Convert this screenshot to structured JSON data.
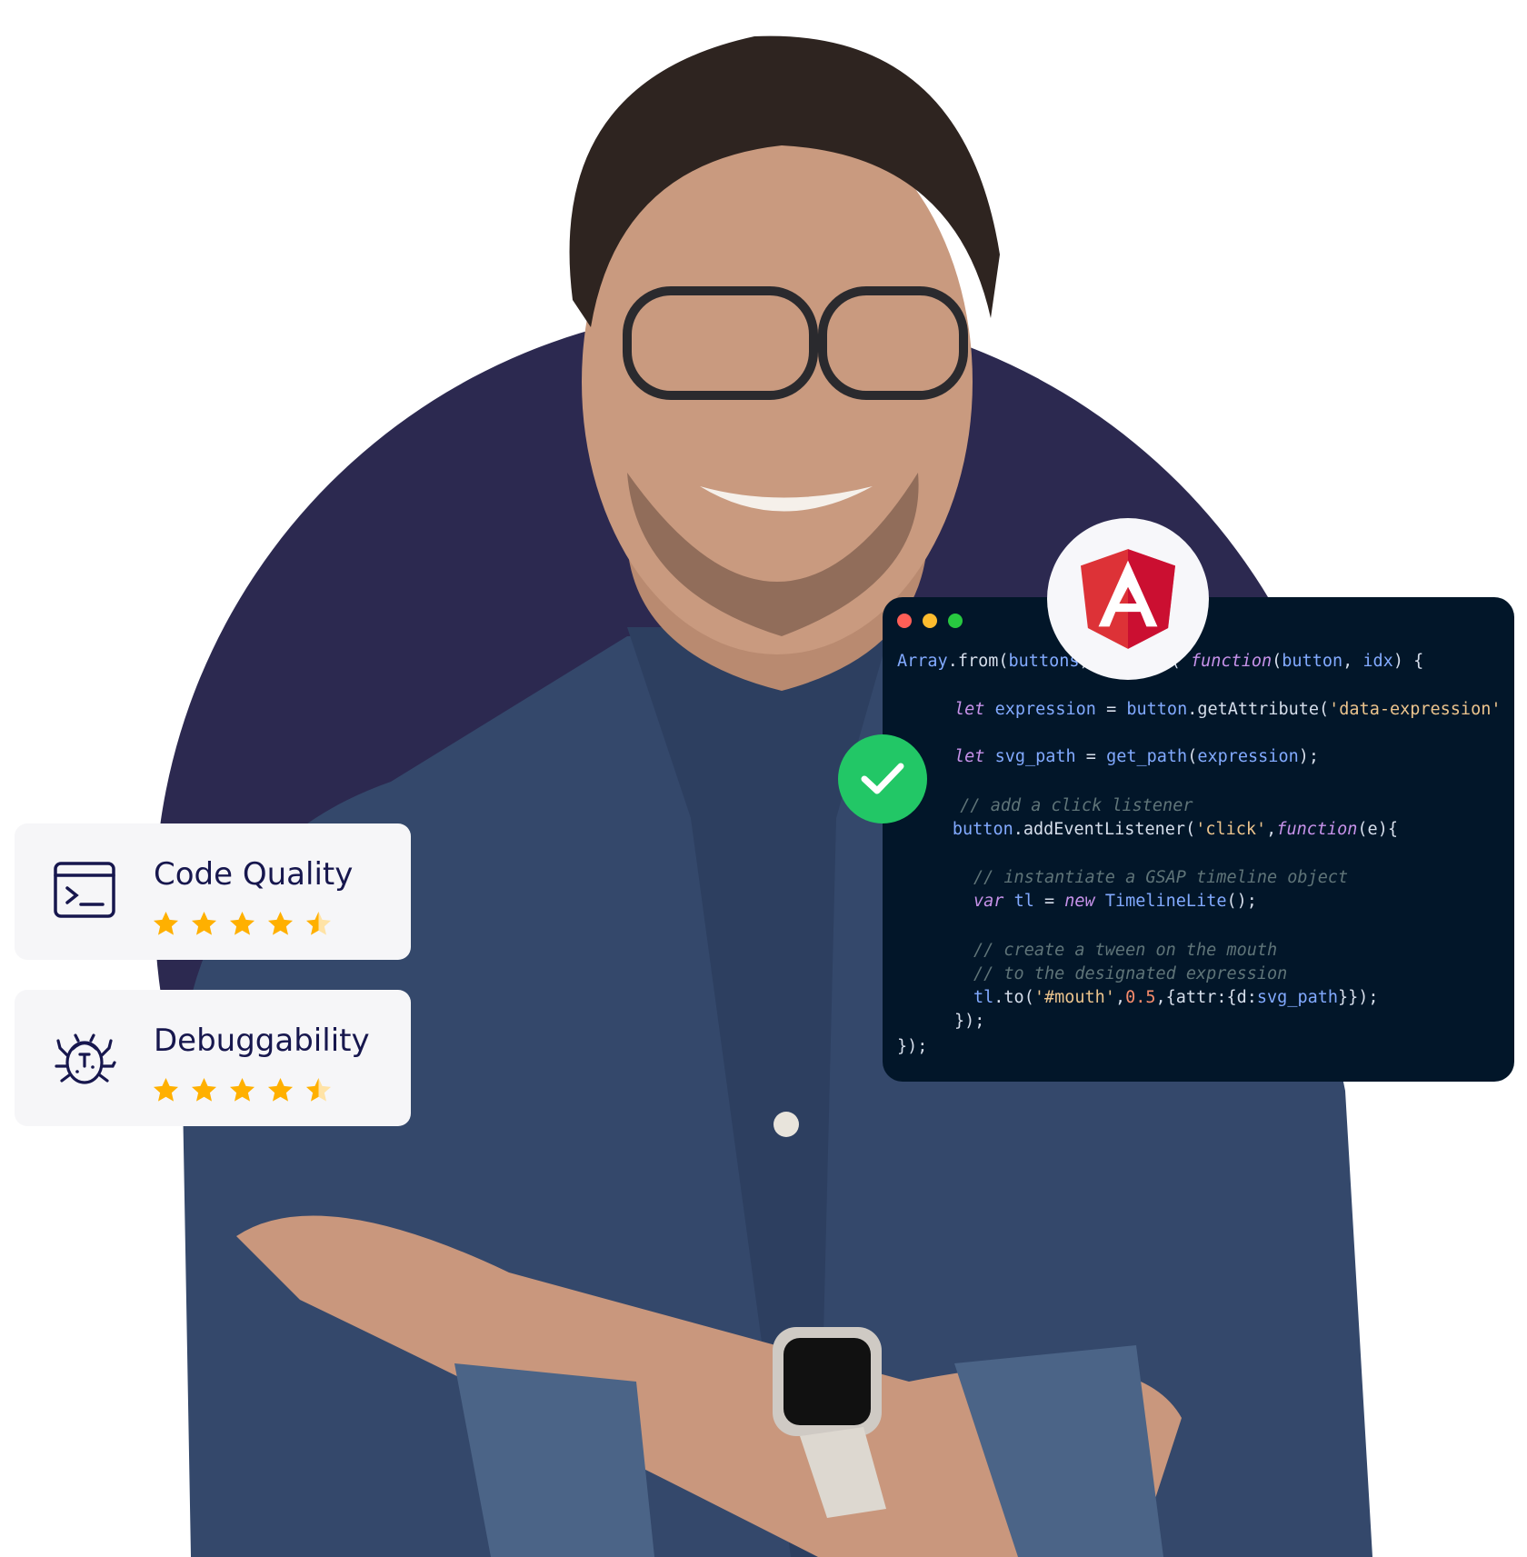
{
  "colors": {
    "circle": "#2c2950",
    "code_bg": "#021629",
    "check": "#22c766",
    "star": "#ffb000",
    "card_text": "#17174e",
    "angular_red": "#dd3237"
  },
  "window_dots": [
    "#ff5f57",
    "#febc2e",
    "#28c840"
  ],
  "badges": {
    "framework": "angular-logo",
    "status": "check-icon"
  },
  "code_lines": [
    {
      "indent": 0,
      "tokens": [
        [
          "Array",
          "id"
        ],
        [
          ".from(",
          "pl"
        ],
        [
          "buttons",
          "id"
        ],
        [
          ").forEach( ",
          "pl"
        ],
        [
          "function",
          "kw"
        ],
        [
          "(",
          "pl"
        ],
        [
          "button",
          "id"
        ],
        [
          ", ",
          "pl"
        ],
        [
          "idx",
          "id"
        ],
        [
          ") {",
          "pl"
        ]
      ]
    },
    {
      "indent": 3,
      "tokens": [
        [
          "let ",
          "kw"
        ],
        [
          "expression",
          "id"
        ],
        [
          " = ",
          "pl"
        ],
        [
          "button",
          "id"
        ],
        [
          ".getAttribute(",
          "pl"
        ],
        [
          "'data-expression'",
          "str"
        ]
      ]
    },
    {
      "indent": 3,
      "tokens": [
        [
          "let ",
          "kw"
        ],
        [
          "svg_path",
          "id"
        ],
        [
          " = ",
          "pl"
        ],
        [
          "get_path",
          "id"
        ],
        [
          "(",
          "pl"
        ],
        [
          "expression",
          "id"
        ],
        [
          ");",
          "pl"
        ]
      ]
    },
    {
      "indent": 3.3,
      "tokens": [
        [
          "// add a click listener",
          "com"
        ]
      ]
    },
    {
      "indent": 2.9,
      "tokens": [
        [
          "button",
          "id"
        ],
        [
          ".addEventListener(",
          "pl"
        ],
        [
          "'click'",
          "str"
        ],
        [
          ",",
          "pl"
        ],
        [
          "function",
          "kw"
        ],
        [
          "(e){",
          "pl"
        ]
      ]
    },
    {
      "indent": 4,
      "tokens": [
        [
          "// instantiate a GSAP timeline object",
          "com"
        ]
      ]
    },
    {
      "indent": 4,
      "tokens": [
        [
          "var ",
          "kw"
        ],
        [
          "tl",
          "id"
        ],
        [
          " = ",
          "pl"
        ],
        [
          "new ",
          "kw"
        ],
        [
          "TimelineLite",
          "id"
        ],
        [
          "();",
          "pl"
        ]
      ]
    },
    {
      "indent": 4,
      "tokens": [
        [
          "// create a tween on the mouth",
          "com"
        ]
      ]
    },
    {
      "indent": 4,
      "tokens": [
        [
          "// to the designated expression",
          "com"
        ]
      ]
    },
    {
      "indent": 4,
      "tokens": [
        [
          "tl",
          "id"
        ],
        [
          ".to(",
          "pl"
        ],
        [
          "'#mouth'",
          "str"
        ],
        [
          ",",
          "pl"
        ],
        [
          "0.5",
          "num"
        ],
        [
          ",{attr:{d:",
          "pl"
        ],
        [
          "svg_path",
          "id"
        ],
        [
          "}});",
          "pl"
        ]
      ]
    },
    {
      "indent": 3,
      "tokens": [
        [
          "});",
          "pl"
        ]
      ]
    },
    {
      "indent": 0,
      "tokens": [
        [
          "});",
          "pl"
        ]
      ]
    }
  ],
  "ratings": [
    {
      "title": "Code Quality",
      "icon": "terminal-icon",
      "rating": 4.5,
      "max": 5
    },
    {
      "title": "Debuggability",
      "icon": "bug-icon",
      "rating": 4.5,
      "max": 5
    }
  ]
}
